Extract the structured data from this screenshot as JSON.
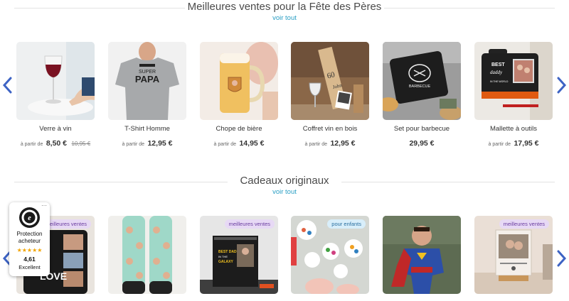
{
  "bestsellers": {
    "title": "Meilleures ventes pour la Fête des Pères",
    "see_all": "voir tout",
    "products": [
      {
        "name": "Verre à vin",
        "from": "à partir de",
        "price": "8,50 €",
        "old_price": "10,95 €"
      },
      {
        "name": "T-Shirt Homme",
        "from": "à partir de",
        "price": "12,95 €"
      },
      {
        "name": "Chope de bière",
        "from": "à partir de",
        "price": "14,95 €"
      },
      {
        "name": "Coffret vin en bois",
        "from": "à partir de",
        "price": "12,95 €"
      },
      {
        "name": "Set pour barbecue",
        "price": "29,95 €"
      },
      {
        "name": "Mallette à outils",
        "from": "à partir de",
        "price": "17,95 €"
      }
    ],
    "image_text": {
      "tshirt_line1": "SUPER",
      "tshirt_line2": "PAPA",
      "box_number": "60",
      "box_name": "John",
      "bbq_text": "BARBECUE",
      "toolbox_line1": "BEST",
      "toolbox_line2": "daddy",
      "toolbox_line3": "IN THE WORLD"
    }
  },
  "originals": {
    "title": "Cadeaux originaux",
    "see_all": "voir tout",
    "badges": [
      "meilleures ventes",
      "meilleures ventes",
      "pour enfants",
      "meilleures ventes"
    ],
    "image_text": {
      "mug_word": "LOVE",
      "calendar_line1": "BEST DAD",
      "calendar_line2": "IN THE",
      "calendar_line3": "GALAXY"
    }
  },
  "trust_badge": {
    "label": "Protection acheteur",
    "stars": "★★★★★",
    "score": "4,61",
    "rating_word": "Excellent",
    "menu": "···"
  },
  "colors": {
    "link": "#2a9fc4",
    "arrow": "#3d63c4",
    "badge_purple_bg": "#e7d9f5",
    "badge_blue_bg": "#d8eefa"
  },
  "icons": {
    "left_arrow": "chevron-left-icon",
    "right_arrow": "chevron-right-icon",
    "trust_seal": "trusted-shops-seal-icon"
  }
}
